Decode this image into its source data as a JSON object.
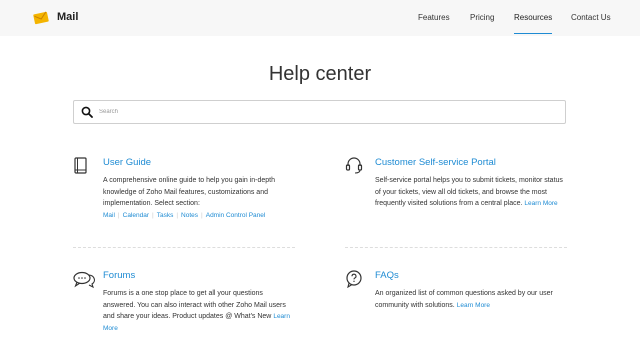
{
  "header": {
    "brand": "Mail",
    "nav": [
      "Features",
      "Pricing",
      "Resources",
      "Contact Us"
    ],
    "active_nav": "Resources"
  },
  "main": {
    "title": "Help center",
    "search": {
      "placeholder": "Search",
      "value": ""
    }
  },
  "cards": {
    "user_guide": {
      "title": "User Guide",
      "desc": "A comprehensive online guide to help you gain in-depth knowledge of Zoho Mail features, customizations and implementation. Select section:",
      "links": [
        "Mail",
        "Calendar",
        "Tasks",
        "Notes",
        "Admin Control Panel"
      ]
    },
    "self_service": {
      "title": "Customer Self-service Portal",
      "desc": "Self-service portal helps you to submit tickets, monitor status of your tickets, view all old tickets, and browse the most frequently visited solutions from a central place.",
      "link": "Learn More"
    },
    "forums": {
      "title": "Forums",
      "desc": "Forums is a one stop place to get all your questions answered. You can also interact with other Zoho Mail users and share your ideas. Product updates @ What's New",
      "link": "Learn More"
    },
    "faqs": {
      "title": "FAQs",
      "desc": "An organized list of common questions asked by our user community with solutions.",
      "link": "Learn More"
    }
  },
  "colors": {
    "accent": "#1e8bd3",
    "header_bg": "#f7f7f7",
    "text": "#333333"
  }
}
